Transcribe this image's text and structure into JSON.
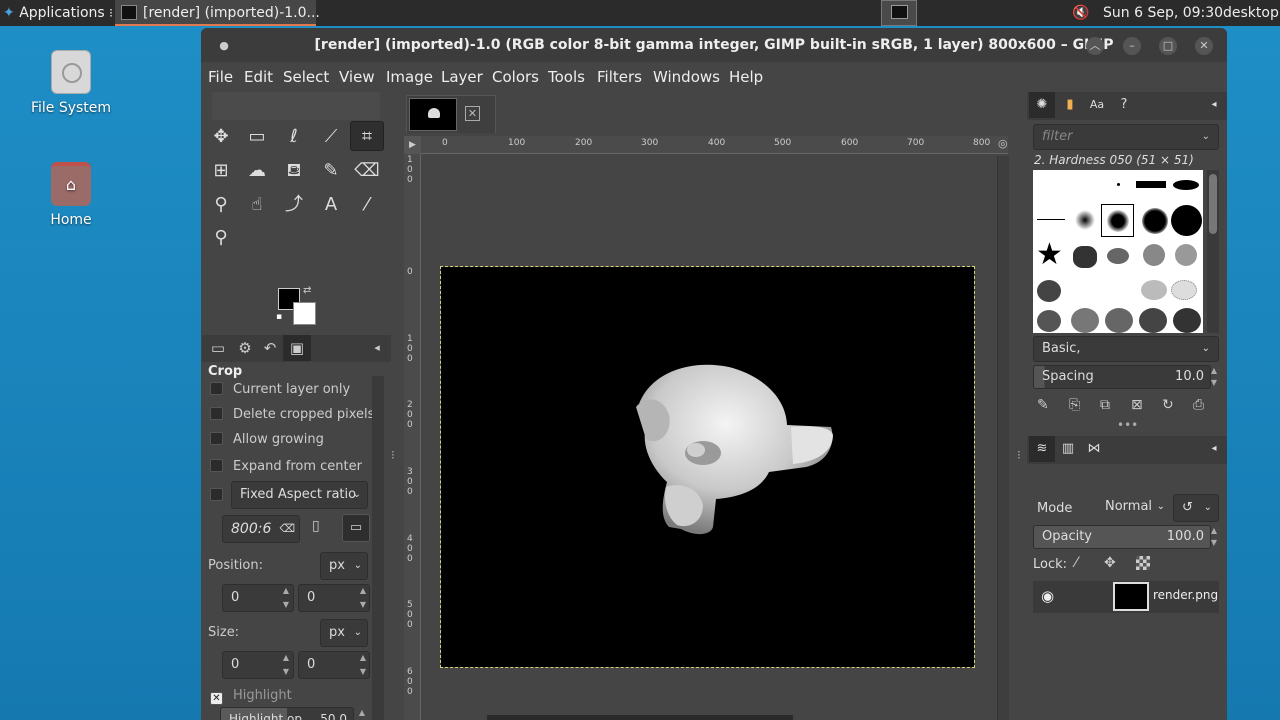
{
  "panel": {
    "applications_label": "Applications",
    "task_title": "[render] (imported)-1.0...",
    "clock": "Sun 6 Sep, 09:30",
    "workspace": "desktop"
  },
  "desktop": {
    "icons": [
      {
        "label": "File System"
      },
      {
        "label": "Home"
      }
    ]
  },
  "window": {
    "title": "[render] (imported)-1.0 (RGB color 8-bit gamma integer, GIMP built-in sRGB, 1 layer) 800x600 – GIMP",
    "menu": [
      "File",
      "Edit",
      "Select",
      "View",
      "Image",
      "Layer",
      "Colors",
      "Tools",
      "Filters",
      "Windows",
      "Help"
    ]
  },
  "tool_options": {
    "title": "Crop",
    "current_layer_only": "Current layer only",
    "delete_cropped": "Delete cropped pixels",
    "allow_growing": "Allow growing",
    "expand_center": "Expand from center",
    "fixed_label": "Fixed",
    "fixed_value": "Aspect ratio",
    "ratio_value": "800:6",
    "position_label": "Position:",
    "position_unit": "px",
    "position_x": "0",
    "position_y": "0",
    "size_label": "Size:",
    "size_unit": "px",
    "size_w": "0",
    "size_h": "0",
    "highlight_label": "Highlight",
    "highlight_opacity_label": "Highlight op...",
    "highlight_opacity_value": "50.0"
  },
  "rulers": {
    "h_ticks": [
      "0",
      "100",
      "200",
      "300",
      "400",
      "500",
      "600",
      "700",
      "800"
    ],
    "v_ticks": [
      "100",
      "0",
      "100",
      "200",
      "300",
      "400",
      "500",
      "600"
    ]
  },
  "brushes": {
    "filter_placeholder": "filter",
    "selected_name": "2. Hardness 050 (51 × 51)",
    "tag_value": "Basic,",
    "spacing_label": "Spacing",
    "spacing_value": "10.0"
  },
  "layers": {
    "mode_label": "Mode",
    "mode_value": "Normal",
    "opacity_label": "Opacity",
    "opacity_value": "100.0",
    "lock_label": "Lock:",
    "layer_name": "render.png"
  },
  "colors": {
    "foreground": "#000000",
    "background": "#ffffff",
    "accent": "#e07a4e",
    "selection_border": "#d6d07a"
  }
}
